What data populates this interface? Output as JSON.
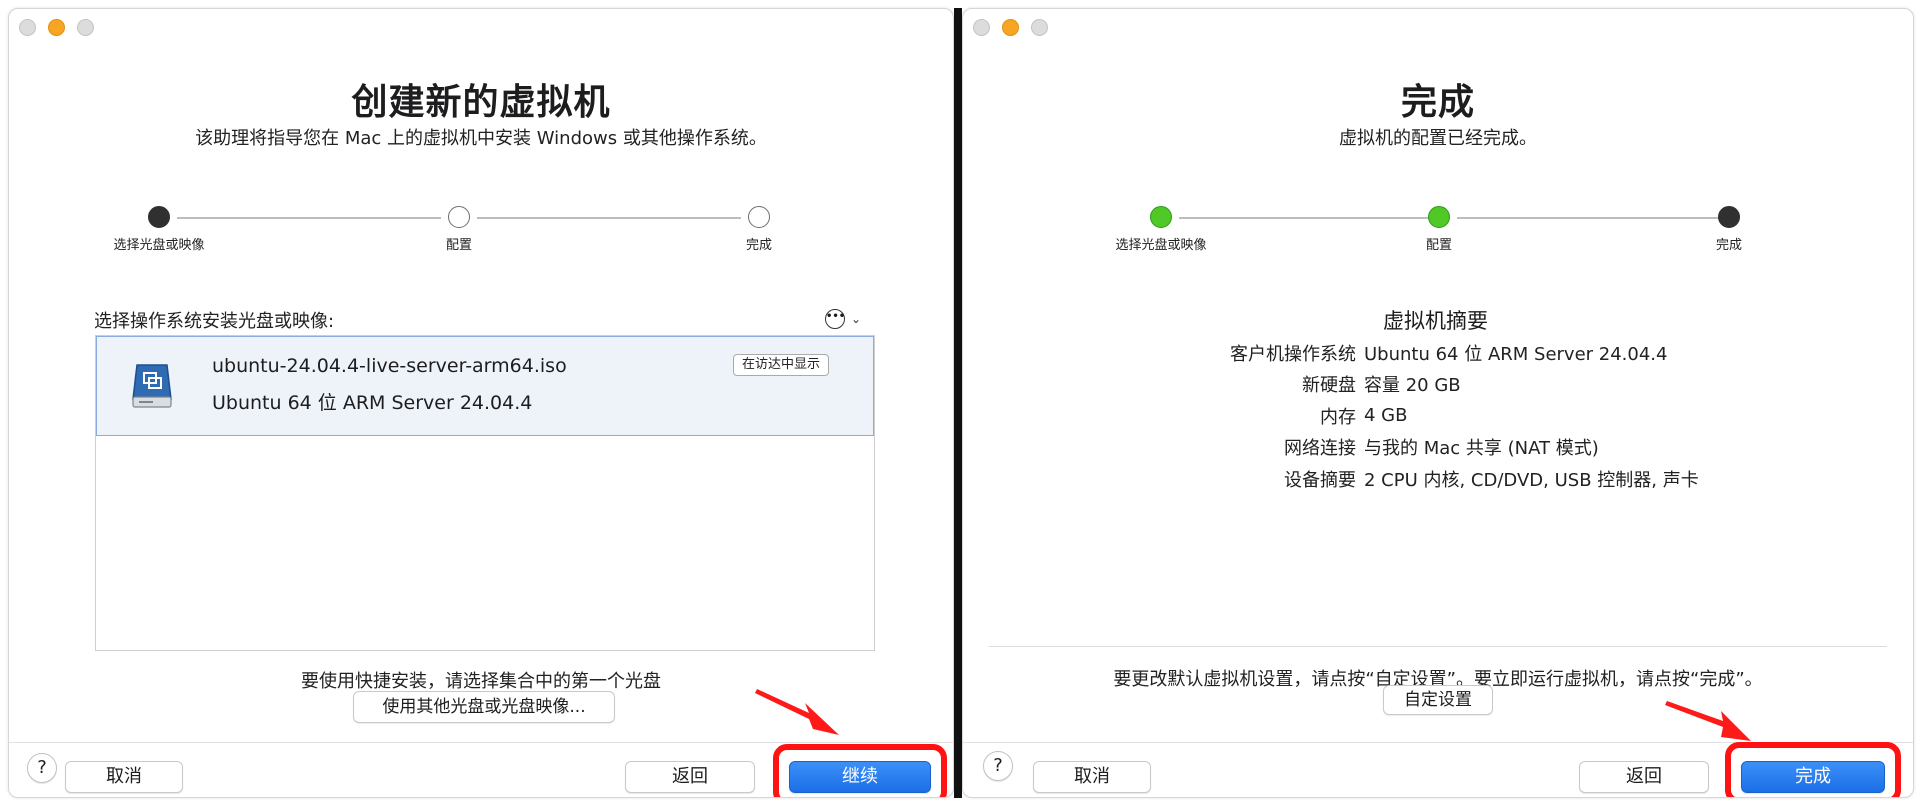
{
  "left_window": {
    "title": "创建新的虚拟机",
    "subtitle": "该助理将指导您在 Mac 上的虚拟机中安装 Windows 或其他操作系统。",
    "steps": [
      {
        "label": "选择光盘或映像",
        "state": "active"
      },
      {
        "label": "配置",
        "state": "pending"
      },
      {
        "label": "完成",
        "state": "pending"
      }
    ],
    "list_label": "选择操作系统安装光盘或映像:",
    "more_icon": "ellipsis-circle-icon",
    "item": {
      "icon": "vmware-disk-icon",
      "filename": "ubuntu-24.04.4-live-server-arm64.iso",
      "os": "Ubuntu 64 位 ARM Server 24.04.4",
      "finder_button": "在访达中显示"
    },
    "hint": "要使用快捷安装，请选择集合中的第一个光盘",
    "alt_button": "使用其他光盘或光盘映像...",
    "help_label": "?",
    "cancel_label": "取消",
    "back_label": "返回",
    "continue_label": "继续"
  },
  "right_window": {
    "title": "完成",
    "subtitle": "虚拟机的配置已经完成。",
    "steps": [
      {
        "label": "选择光盘或映像",
        "state": "done"
      },
      {
        "label": "配置",
        "state": "done"
      },
      {
        "label": "完成",
        "state": "active"
      }
    ],
    "summary_title": "虚拟机摘要",
    "summary": [
      {
        "key": "客户机操作系统",
        "value": "Ubuntu 64 位 ARM Server 24.04.4"
      },
      {
        "key": "新硬盘",
        "value": "容量 20 GB"
      },
      {
        "key": "内存",
        "value": "4 GB"
      },
      {
        "key": "网络连接",
        "value": "与我的 Mac 共享 (NAT 模式)"
      },
      {
        "key": "设备摘要",
        "value": "2 CPU 内核, CD/DVD, USB 控制器, 声卡"
      }
    ],
    "hint": "要更改默认虚拟机设置，请点按“自定设置”。要立即运行虚拟机，请点按“完成”。",
    "custom_button": "自定设置",
    "help_label": "?",
    "cancel_label": "取消",
    "back_label": "返回",
    "finish_label": "完成"
  },
  "colors": {
    "accent": "#1b6fe6",
    "highlight": "#ff1212",
    "step_done": "#4fc828",
    "step_active": "#303030",
    "selection_bg": "#eef3fa"
  }
}
